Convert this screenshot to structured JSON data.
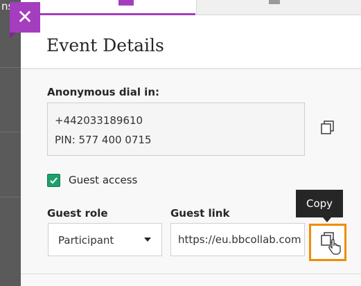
{
  "background": {
    "partial_text": "ns"
  },
  "header": {
    "title": "Event Details"
  },
  "dial_in": {
    "label": "Anonymous dial in:",
    "phone": "+442033189610",
    "pin": "PIN: 577 400 0715"
  },
  "guest_access": {
    "label": "Guest access",
    "checked": true
  },
  "guest_role": {
    "label": "Guest role",
    "value": "Participant"
  },
  "guest_link": {
    "label": "Guest link",
    "value": "https://eu.bbcollab.com"
  },
  "tooltip": {
    "text": "Copy"
  },
  "icons": {
    "close": "close-icon",
    "copy": "copy-icon",
    "check": "check-icon",
    "dropdown": "chevron-down-icon",
    "cursor": "hand-pointer-icon"
  },
  "colors": {
    "accent": "#a53dbf",
    "focus": "#f08c00",
    "checkbox": "#1fa06a",
    "tooltip_bg": "#262626"
  }
}
